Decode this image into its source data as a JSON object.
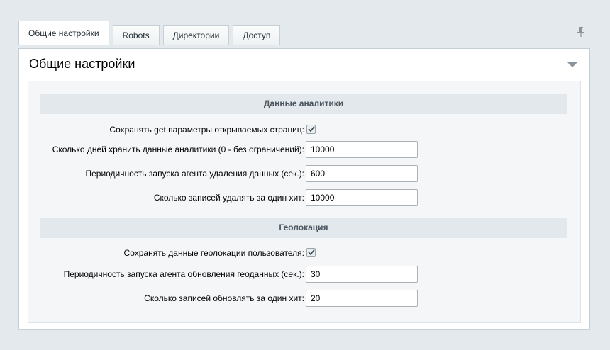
{
  "tabs": [
    {
      "label": "Общие настройки",
      "active": true
    },
    {
      "label": "Robots",
      "active": false
    },
    {
      "label": "Директории",
      "active": false
    },
    {
      "label": "Доступ",
      "active": false
    }
  ],
  "icons": {
    "pin": "pin-icon",
    "collapse": "chevron-down-icon",
    "check": "checkmark-icon"
  },
  "panel": {
    "title": "Общие настройки"
  },
  "sections": {
    "analytics": {
      "title": "Данные аналитики",
      "save_get_label": "Сохранять get параметры открываемых страниц:",
      "save_get_checked": true,
      "keep_days_label": "Сколько дней хранить данные аналитики (0 - без ограничений):",
      "keep_days_value": "10000",
      "cleanup_period_label": "Периодичность запуска агента удаления данных (сек.):",
      "cleanup_period_value": "600",
      "delete_per_hit_label": "Сколько записей удалять за один хит:",
      "delete_per_hit_value": "10000"
    },
    "geo": {
      "title": "Геолокация",
      "save_geo_label": "Сохранять данные геолокации пользователя:",
      "save_geo_checked": true,
      "update_period_label": "Периодичность запуска агента обновления геоданных (сек.):",
      "update_period_value": "30",
      "update_per_hit_label": "Сколько записей обновлять за один хит:",
      "update_per_hit_value": "20"
    }
  }
}
